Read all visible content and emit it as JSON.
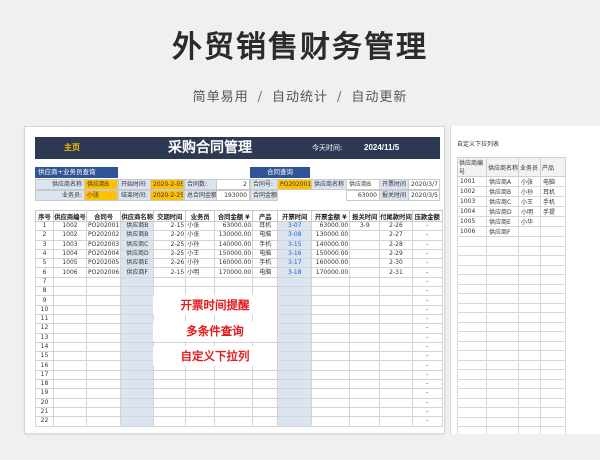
{
  "hero": {
    "title": "外贸销售财务管理",
    "features": [
      "简单易用",
      "自动统计",
      "自动更新"
    ],
    "separator": "/"
  },
  "sheet": {
    "home_label": "主页",
    "title": "采购合同管理",
    "today_label": "今天时间:",
    "today_value": "2024/11/5",
    "supplier_query": {
      "header": "供应商+业务员查询",
      "supplier_label": "供应商名称",
      "supplier_value": "供应商B",
      "staff_label": "业务员:",
      "staff_value": "小张",
      "start_label": "开始时间:",
      "start_value": "2020-2-05",
      "end_label": "结束时间:",
      "end_value": "2020-2-25",
      "count_label": "合同数:",
      "count_value": "2",
      "total_label": "总合同金额:",
      "total_value": "193000"
    },
    "contract_query": {
      "header": "合同查询",
      "no_label": "合同号:",
      "no_value": "PO202001",
      "supplier_label": "供应商名称",
      "supplier_value": "供应商B",
      "amount_label": "合同金额:",
      "amount_value": "63000",
      "invoice_label": "开票时间",
      "invoice_value": "2020/3/7",
      "report_label": "报关时间",
      "report_value": "2020/3/5"
    },
    "columns": [
      "序号",
      "供应商编号",
      "合同号",
      "供应商名称",
      "交期时间",
      "业务员",
      "合同金额 ¥",
      "产品",
      "开票时间",
      "开票金额 ¥",
      "报关时间",
      "付尾款时间",
      "压款金额"
    ],
    "rows": [
      [
        "1",
        "1002",
        "PO202001",
        "供应商B",
        "2-15",
        "小张",
        "63000.00",
        "耳机",
        "3-07",
        "63000.00",
        "3-9",
        "2-26",
        "-"
      ],
      [
        "2",
        "1002",
        "PO202002",
        "供应商B",
        "2-20",
        "小张",
        "130000.00",
        "电脑",
        "3-08",
        "130000.00",
        "",
        "2-27",
        "-"
      ],
      [
        "3",
        "1003",
        "PO202003",
        "供应商C",
        "2-25",
        "小孙",
        "140000.00",
        "手机",
        "3-15",
        "140000.00",
        "",
        "2-28",
        "-"
      ],
      [
        "4",
        "1004",
        "PO202004",
        "供应商D",
        "2-25",
        "小王",
        "150000.00",
        "电脑",
        "3-16",
        "150000.00",
        "",
        "2-29",
        "-"
      ],
      [
        "5",
        "1005",
        "PO202005",
        "供应商E",
        "2-26",
        "小孙",
        "160000.00",
        "手机",
        "3-17",
        "160000.00",
        "",
        "2-30",
        "-"
      ],
      [
        "6",
        "1006",
        "PO202006",
        "供应商F",
        "2-15",
        "小明",
        "170000.00",
        "电脑",
        "3-18",
        "170000.00",
        "",
        "2-31",
        "-"
      ],
      [
        "7",
        "",
        "",
        "",
        "",
        "",
        "",
        "",
        "",
        "",
        "",
        "",
        "-"
      ],
      [
        "8",
        "",
        "",
        "",
        "",
        "",
        "",
        "",
        "",
        "",
        "",
        "",
        "-"
      ],
      [
        "9",
        "",
        "",
        "",
        "",
        "",
        "",
        "",
        "",
        "",
        "",
        "",
        "-"
      ],
      [
        "10",
        "",
        "",
        "",
        "",
        "",
        "",
        "",
        "",
        "",
        "",
        "",
        "-"
      ],
      [
        "11",
        "",
        "",
        "",
        "",
        "",
        "",
        "",
        "",
        "",
        "",
        "",
        "-"
      ],
      [
        "12",
        "",
        "",
        "",
        "",
        "",
        "",
        "",
        "",
        "",
        "",
        "",
        "-"
      ],
      [
        "13",
        "",
        "",
        "",
        "",
        "",
        "",
        "",
        "",
        "",
        "",
        "",
        "-"
      ],
      [
        "14",
        "",
        "",
        "",
        "",
        "",
        "",
        "",
        "",
        "",
        "",
        "",
        "-"
      ],
      [
        "15",
        "",
        "",
        "",
        "",
        "",
        "",
        "",
        "",
        "",
        "",
        "",
        "-"
      ],
      [
        "16",
        "",
        "",
        "",
        "",
        "",
        "",
        "",
        "",
        "",
        "",
        "",
        "-"
      ],
      [
        "17",
        "",
        "",
        "",
        "",
        "",
        "",
        "",
        "",
        "",
        "",
        "",
        "-"
      ],
      [
        "18",
        "",
        "",
        "",
        "",
        "",
        "",
        "",
        "",
        "",
        "",
        "",
        "-"
      ],
      [
        "19",
        "",
        "",
        "",
        "",
        "",
        "",
        "",
        "",
        "",
        "",
        "",
        "-"
      ],
      [
        "20",
        "",
        "",
        "",
        "",
        "",
        "",
        "",
        "",
        "",
        "",
        "",
        "-"
      ],
      [
        "21",
        "",
        "",
        "",
        "",
        "",
        "",
        "",
        "",
        "",
        "",
        "",
        "-"
      ],
      [
        "22",
        "",
        "",
        "",
        "",
        "",
        "",
        "",
        "",
        "",
        "",
        "",
        "-"
      ]
    ],
    "annotations": [
      "开票时间提醒",
      "多条件查询",
      "自定义下拉列"
    ]
  },
  "side": {
    "title": "自定义下拉列表",
    "columns": [
      "供应商编号",
      "供应商名称",
      "业务员",
      "产品"
    ],
    "rows": [
      [
        "1001",
        "供应商A",
        "小张",
        "电脑"
      ],
      [
        "1002",
        "供应商B",
        "小孙",
        "耳机"
      ],
      [
        "1003",
        "供应商C",
        "小王",
        "手机"
      ],
      [
        "1004",
        "供应商D",
        "小明",
        "手提"
      ],
      [
        "1005",
        "供应商E",
        "小华",
        ""
      ],
      [
        "1006",
        "供应商F",
        "",
        ""
      ],
      [
        "",
        "",
        "",
        ""
      ],
      [
        "",
        "",
        "",
        ""
      ],
      [
        "",
        "",
        "",
        ""
      ],
      [
        "",
        "",
        "",
        ""
      ],
      [
        "",
        "",
        "",
        ""
      ],
      [
        "",
        "",
        "",
        ""
      ],
      [
        "",
        "",
        "",
        ""
      ],
      [
        "",
        "",
        "",
        ""
      ],
      [
        "",
        "",
        "",
        ""
      ],
      [
        "",
        "",
        "",
        ""
      ],
      [
        "",
        "",
        "",
        ""
      ],
      [
        "",
        "",
        "",
        ""
      ],
      [
        "",
        "",
        "",
        ""
      ],
      [
        "",
        "",
        "",
        ""
      ],
      [
        "",
        "",
        "",
        ""
      ],
      [
        "",
        "",
        "",
        ""
      ],
      [
        "",
        "",
        "",
        ""
      ],
      [
        "",
        "",
        "",
        ""
      ],
      [
        "",
        "",
        "",
        ""
      ],
      [
        "",
        "",
        "",
        ""
      ],
      [
        "",
        "",
        "",
        ""
      ]
    ]
  },
  "colors": {
    "header_navy": "#2e3a54",
    "query_blue": "#2f5597",
    "highlight_yellow": "#ffc000",
    "label_blue": "#dbe5f1",
    "annotation_red": "#e21c1c",
    "date_blue": "#1f5fd6"
  }
}
